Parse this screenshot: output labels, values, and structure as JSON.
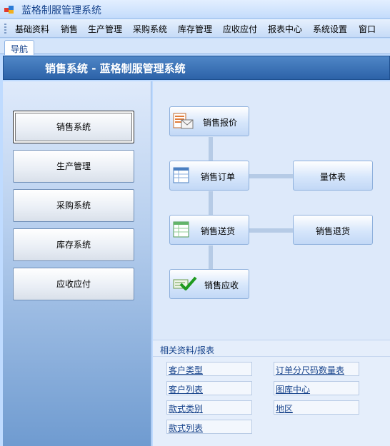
{
  "window": {
    "title": "蓝格制服管理系统"
  },
  "menu": [
    "基础资料",
    "销售",
    "生产管理",
    "采购系统",
    "库存管理",
    "应收应付",
    "报表中心",
    "系统设置",
    "窗口"
  ],
  "tab": {
    "label": "导航"
  },
  "banner": {
    "title": "销售系统 - 蓝格制服管理系统"
  },
  "nav": [
    "销售系统",
    "生产管理",
    "采购系统",
    "库存系统",
    "应收应付"
  ],
  "flow": {
    "quote": "销售报价",
    "order": "销售订单",
    "measure": "量体表",
    "delivery": "销售送货",
    "return": "销售退货",
    "receivable": "销售应收"
  },
  "related": {
    "title": "相关资料/报表",
    "links": [
      "客户类型",
      "订单分尺码数量表",
      "客户列表",
      "图库中心",
      "款式类别",
      "地区",
      "款式列表"
    ]
  }
}
